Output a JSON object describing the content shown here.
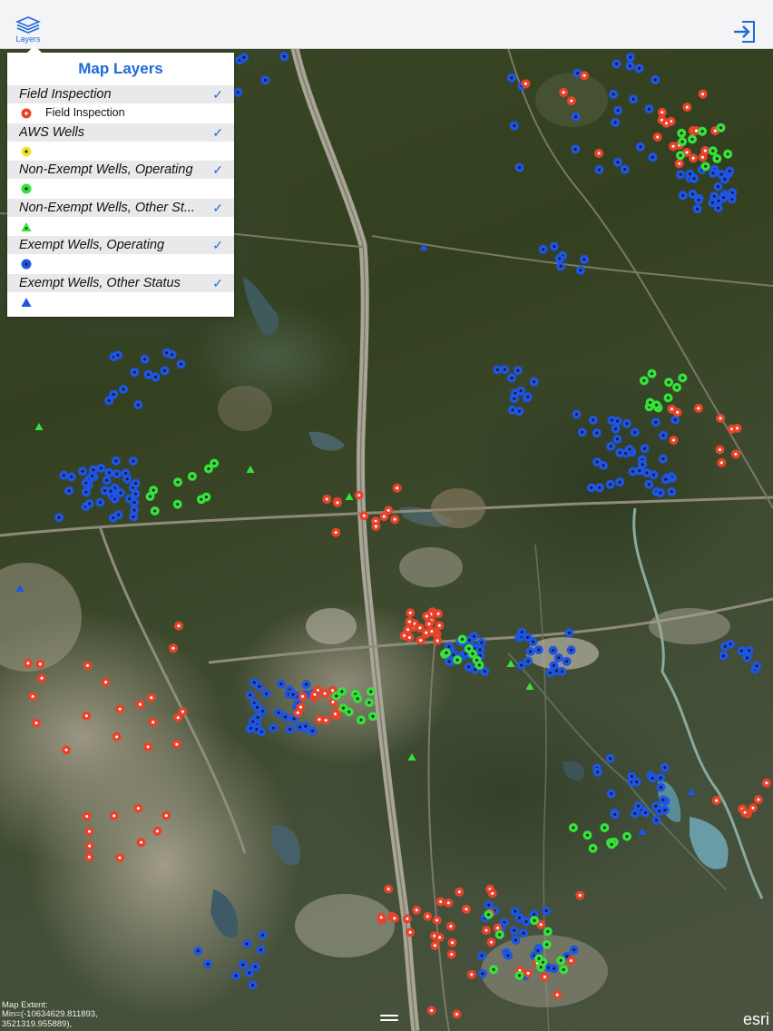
{
  "toolbar": {
    "layers_label": "Layers",
    "layers_icon": "layers-icon",
    "signin_icon": "sign-in-icon"
  },
  "panel": {
    "title": "Map Layers",
    "layers": [
      {
        "name": "Field Inspection",
        "checked": true,
        "symbol": "dot",
        "color": "#e8432a",
        "symbol_label": "Field Inspection"
      },
      {
        "name": "AWS Wells",
        "checked": true,
        "symbol": "dot",
        "color": "#f2e624",
        "symbol_label": ""
      },
      {
        "name": "Non-Exempt Wells, Operating",
        "checked": true,
        "symbol": "dot",
        "color": "#35e23a",
        "symbol_label": ""
      },
      {
        "name": "Non-Exempt Wells, Other St...",
        "checked": true,
        "symbol": "triangle",
        "color": "#35e23a",
        "symbol_label": ""
      },
      {
        "name": "Exempt Wells, Operating",
        "checked": true,
        "symbol": "dot",
        "color": "#1f55e6",
        "symbol_label": ""
      },
      {
        "name": "Exempt Wells, Other Status",
        "checked": true,
        "symbol": "triangle",
        "color": "#1f55e6",
        "symbol_label": ""
      }
    ]
  },
  "map": {
    "extent_line1": "Map Extent:",
    "extent_line2": "Min=(-10634629.811893,",
    "extent_line3": "3521319.955889),",
    "attribution": "esri"
  },
  "colors": {
    "accent": "#1e6ad8",
    "field_inspection": "#e8432a",
    "non_exempt": "#35e23a",
    "exempt": "#1f55e6"
  }
}
